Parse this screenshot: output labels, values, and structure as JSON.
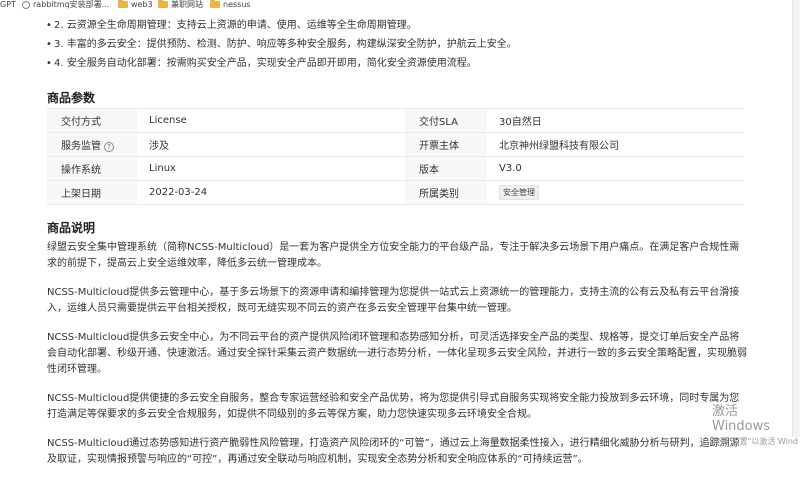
{
  "bookmarks": [
    {
      "label": "GPT",
      "icon": "none"
    },
    {
      "label": "rabbitmq安装部署...",
      "icon": "globe-icon"
    },
    {
      "label": "web3",
      "icon": "folder-icon"
    },
    {
      "label": "兼职网站",
      "icon": "folder-icon"
    },
    {
      "label": "nessus",
      "icon": "folder-icon"
    }
  ],
  "features": [
    "2. 云资源全生命周期管理：支持云上资源的申请、使用、运维等全生命周期管理。",
    "3. 丰富的多云安全：提供预防、检测、防护、响应等多种安全服务，构建纵深安全防护，护航云上安全。",
    "4. 安全服务自动化部署：按需购买安全产品，实现安全产品即开即用，简化安全资源使用流程。"
  ],
  "params_title": "商品参数",
  "params": {
    "rows": [
      {
        "label": "交付方式",
        "value": "License",
        "label2": "交付SLA",
        "value2": "30自然日"
      },
      {
        "label": "服务监管",
        "value": "涉及",
        "label2": "开票主体",
        "value2": "北京神州绿盟科技有限公司"
      },
      {
        "label": "操作系统",
        "value": "Linux",
        "label2": "版本",
        "value2": "V3.0"
      },
      {
        "label": "上架日期",
        "value": "2022-03-24",
        "label2": "所属类别",
        "value2": "安全管理"
      }
    ],
    "help_icon": "?"
  },
  "desc_title": "商品说明",
  "description": [
    "绿盟云安全集中管理系统（简称NCSS-Multicloud）是一套为客户提供全方位安全能力的平台级产品，专注于解决多云场景下用户痛点。在满足客户合规性需求的前提下，提高云上安全运维效率，降低多云统一管理成本。",
    "NCSS-Multicloud提供多云管理中心，基于多云场景下的资源申请和编排管理为您提供一站式云上资源统一的管理能力，支持主流的公有云及私有云平台滑接入，运维人员只需要提供云平台相关授权，既可无缝实现不同云的资产在多云安全管理平台集中统一管理。",
    "NCSS-Multicloud提供多云安全中心，为不同云平台的资产提供风险闭环管理和态势感知分析，可灵活选择安全产品的类型、规格等，提交订单后安全产品将会自动化部署、秒级开通、快速激活。通过安全探针采集云资产数据统一进行态势分析，一体化呈现多云安全风险，并进行一致的多云安全策略配置，实现脆弱性闭环管理。",
    "NCSS-Multicloud提供便捷的多云安全自服务，整合专家运营经验和安全产品优势，将为您提供引导式自服务实现将安全能力投放到多云环境，同时专属为您打造满足等保要求的多云安全合规服务，如提供不同级别的多云等保方案，助力您快速实现多云环境安全合规。",
    "NCSS-Multicloud通过态势感知进行资产脆弱性风险管理，打造资产风险闭环的“可管”，通过云上海量数据柔性接入，进行精细化威胁分析与研判，追踪溯源及取证，实现情报预警与响应的“可控”，再通过安全联动与响应机制，实现安全态势分析和安全响应体系的“可持续运营”。"
  ],
  "watermark": {
    "line1": "激活 Windows",
    "line2": "转到\"设置\"以激活 Wind"
  }
}
